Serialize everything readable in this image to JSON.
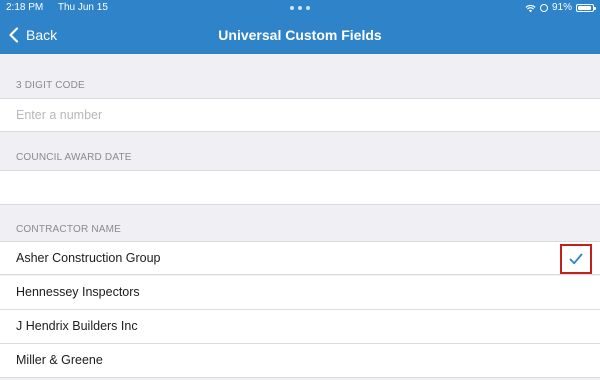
{
  "status_bar": {
    "time": "2:18 PM",
    "date": "Thu Jun 15",
    "battery_percent": "91%",
    "battery_level": 0.91,
    "icons": [
      "wifi-icon",
      "screen-lock-icon",
      "battery-icon"
    ]
  },
  "nav": {
    "back_label": "Back",
    "title": "Universal Custom Fields",
    "back_icon": "chevron-left-icon"
  },
  "fields": [
    {
      "header": "3 DIGIT CODE",
      "placeholder": "Enter a number",
      "value": ""
    },
    {
      "header": "COUNCIL AWARD DATE",
      "placeholder": "",
      "value": ""
    }
  ],
  "contractor": {
    "header": "CONTRACTOR NAME",
    "options": [
      {
        "label": "Asher Construction Group",
        "selected": true
      },
      {
        "label": "Hennessey Inspectors",
        "selected": false
      },
      {
        "label": "J Hendrix Builders Inc",
        "selected": false
      },
      {
        "label": "Miller & Greene",
        "selected": false
      }
    ],
    "selected_icon": "checkmark-icon"
  },
  "colors": {
    "header_bg": "#2e83c9",
    "background": "#efeff4",
    "checkmark": "#2e83c9",
    "highlight_box": "#c0201e"
  }
}
